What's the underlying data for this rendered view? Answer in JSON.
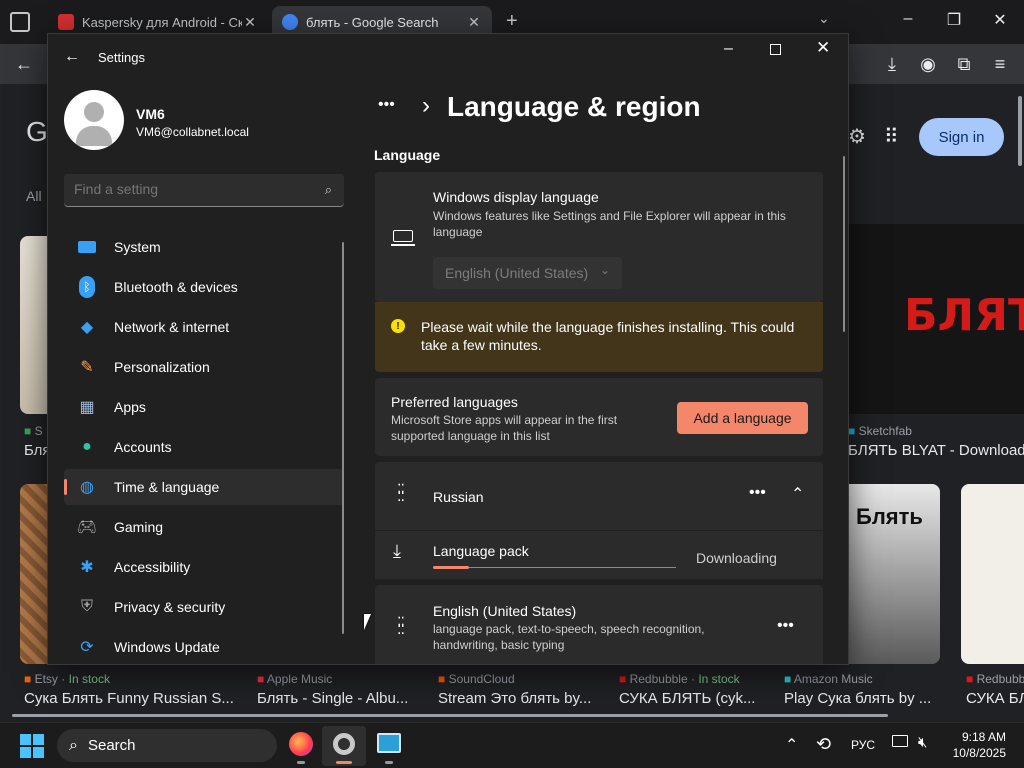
{
  "browser": {
    "tabs": [
      {
        "title": "Kaspersky для Android - Скача",
        "favicon_color": "#d32f2f"
      },
      {
        "title": "блять - Google Search",
        "favicon_color": "#4285f4"
      }
    ],
    "new_tab": "+",
    "sign_in": "Sign in",
    "google_partial": "G",
    "all_partial": "All"
  },
  "results": [
    {
      "source": "Etsy",
      "stock": "In stock",
      "title": "Сука Блять Funny Russian S..."
    },
    {
      "source": "Apple Music",
      "stock": "",
      "title": "Блять - Single - Albu..."
    },
    {
      "source": "SoundCloud",
      "stock": "",
      "title": "Stream Это блять by..."
    },
    {
      "source": "Redbubble",
      "stock": "In stock",
      "title": "СУКА БЛЯТЬ (cyk..."
    },
    {
      "source": "Amazon Music",
      "stock": "",
      "title": "Play Сука блять by ..."
    },
    {
      "source": "Redbubb",
      "stock": "",
      "title": "СУКА БЛ"
    }
  ],
  "results_top": {
    "sketchfab_source": "Sketchfab",
    "sketchfab_title": "БЛЯТЬ BLYAT - Download F",
    "left_source": "S",
    "left_title": "Бля"
  },
  "settings": {
    "app_title": "Settings",
    "user": {
      "name": "VM6",
      "email": "VM6@collabnet.local"
    },
    "search_placeholder": "Find a setting",
    "nav": [
      {
        "label": "System",
        "icon": "monitor-icon"
      },
      {
        "label": "Bluetooth & devices",
        "icon": "bluetooth-icon"
      },
      {
        "label": "Network & internet",
        "icon": "wifi-icon"
      },
      {
        "label": "Personalization",
        "icon": "brush-icon"
      },
      {
        "label": "Apps",
        "icon": "apps-icon"
      },
      {
        "label": "Accounts",
        "icon": "person-icon"
      },
      {
        "label": "Time & language",
        "icon": "globe-clock-icon"
      },
      {
        "label": "Gaming",
        "icon": "gamepad-icon"
      },
      {
        "label": "Accessibility",
        "icon": "accessibility-icon"
      },
      {
        "label": "Privacy & security",
        "icon": "shield-icon"
      },
      {
        "label": "Windows Update",
        "icon": "update-icon"
      }
    ],
    "selected_nav": "Time & language",
    "breadcrumb_more": "•••",
    "breadcrumb_sep": "›",
    "page_title": "Language & region",
    "section_language": "Language",
    "display_language": {
      "title": "Windows display language",
      "desc": "Windows features like Settings and File Explorer will appear in this language",
      "value": "English (United States)"
    },
    "warning": "Please wait while the language finishes installing. This could take a few minutes.",
    "preferred": {
      "title": "Preferred languages",
      "desc": "Microsoft Store apps will appear in the first supported language in this list",
      "button": "Add a language"
    },
    "languages": [
      {
        "name": "Russian",
        "detail": ""
      },
      {
        "name": "English (United States)",
        "detail": "language pack, text-to-speech, speech recognition, handwriting, basic typing"
      }
    ],
    "language_pack": {
      "label": "Language pack",
      "status": "Downloading",
      "progress": 0.15
    }
  },
  "taskbar": {
    "search": "Search",
    "lang": "РУС",
    "time": "9:18 AM",
    "date": "10/8/2025"
  },
  "colors": {
    "accent": "#f4866a",
    "warning_bg": "#433519",
    "warning_icon": "#fce100"
  }
}
